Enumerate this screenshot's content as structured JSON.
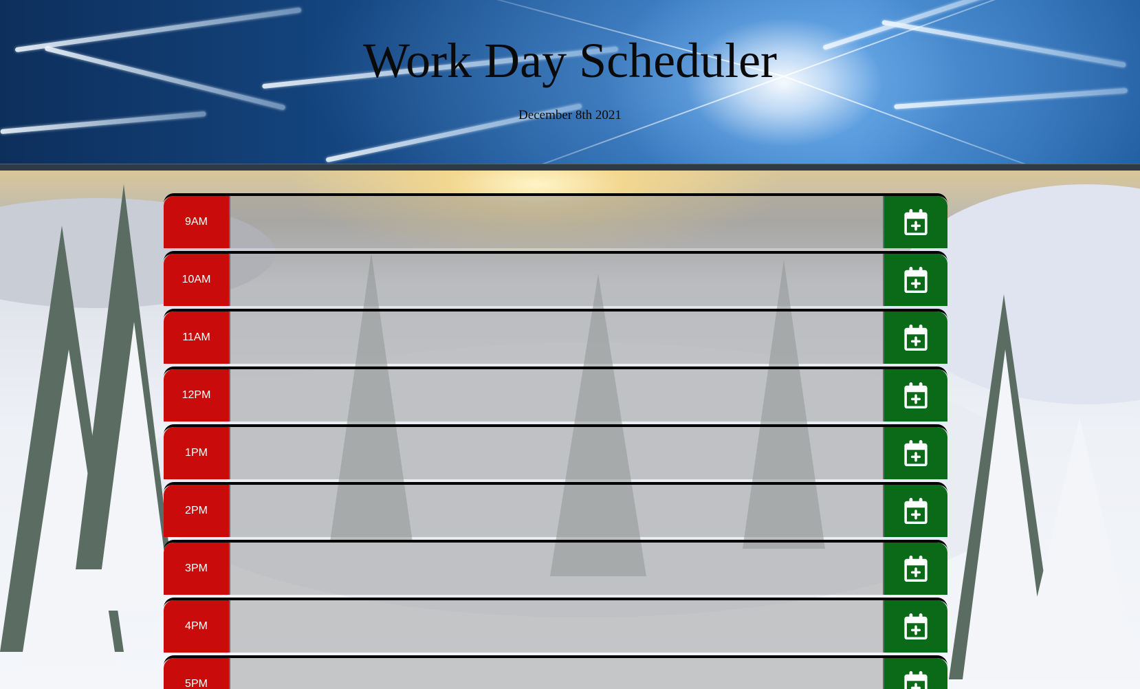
{
  "header": {
    "title": "Work Day Scheduler",
    "current_date": "December 8th 2021"
  },
  "colors": {
    "past": "#c90b0b",
    "save": "#0a6a18",
    "description_bg": "rgba(150,150,150,0.5)"
  },
  "time_blocks": [
    {
      "hour": "9AM",
      "description": "",
      "status": "past",
      "save_icon": "calendar-plus-icon"
    },
    {
      "hour": "10AM",
      "description": "",
      "status": "past",
      "save_icon": "calendar-plus-icon"
    },
    {
      "hour": "11AM",
      "description": "",
      "status": "past",
      "save_icon": "calendar-plus-icon"
    },
    {
      "hour": "12PM",
      "description": "",
      "status": "past",
      "save_icon": "calendar-plus-icon"
    },
    {
      "hour": "1PM",
      "description": "",
      "status": "past",
      "save_icon": "calendar-plus-icon"
    },
    {
      "hour": "2PM",
      "description": "",
      "status": "past",
      "save_icon": "calendar-plus-icon"
    },
    {
      "hour": "3PM",
      "description": "",
      "status": "past",
      "save_icon": "calendar-plus-icon"
    },
    {
      "hour": "4PM",
      "description": "",
      "status": "past",
      "save_icon": "calendar-plus-icon"
    },
    {
      "hour": "5PM",
      "description": "",
      "status": "past",
      "save_icon": "calendar-plus-icon"
    }
  ]
}
